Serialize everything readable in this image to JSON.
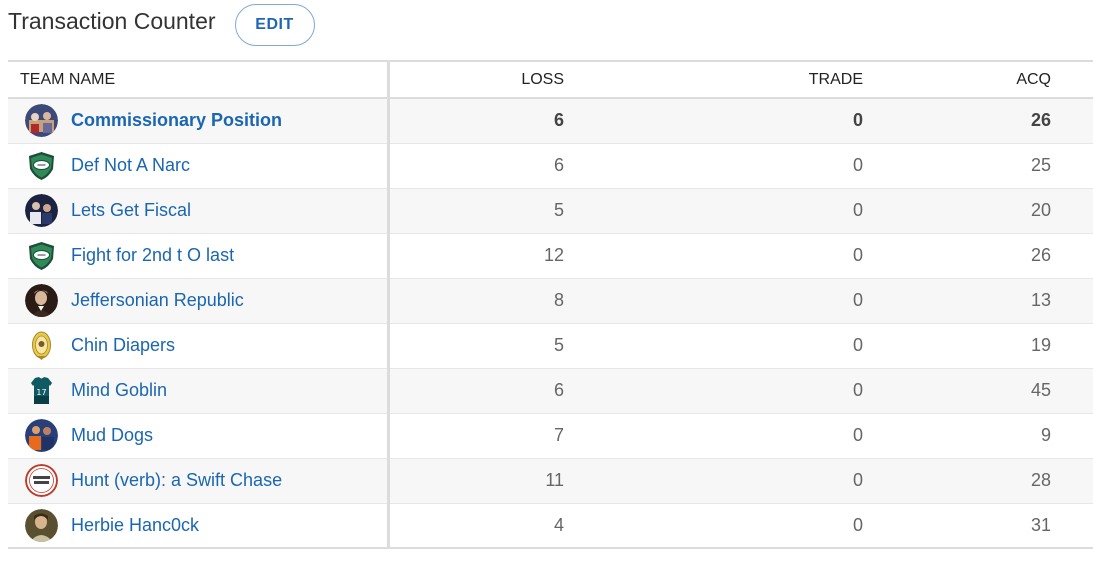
{
  "header": {
    "title": "Transaction Counter",
    "edit_label": "EDIT"
  },
  "columns": {
    "team": "TEAM NAME",
    "loss": "LOSS",
    "trade": "TRADE",
    "acq": "ACQ"
  },
  "rows": [
    {
      "team": "Commissionary Position",
      "loss": "6",
      "trade": "0",
      "acq": "26",
      "avatar": "team-photo-avatar",
      "highlight": true
    },
    {
      "team": "Def Not A Narc",
      "loss": "6",
      "trade": "0",
      "acq": "25",
      "avatar": "football-shield-icon",
      "highlight": false
    },
    {
      "team": "Lets Get Fiscal",
      "loss": "5",
      "trade": "0",
      "acq": "20",
      "avatar": "team-photo-avatar",
      "highlight": false
    },
    {
      "team": "Fight for 2nd t O last",
      "loss": "12",
      "trade": "0",
      "acq": "26",
      "avatar": "football-shield-icon",
      "highlight": false
    },
    {
      "team": "Jeffersonian Republic",
      "loss": "8",
      "trade": "0",
      "acq": "13",
      "avatar": "portrait-avatar",
      "highlight": false
    },
    {
      "team": "Chin Diapers",
      "loss": "5",
      "trade": "0",
      "acq": "19",
      "avatar": "crest-avatar",
      "highlight": false
    },
    {
      "team": "Mind Goblin",
      "loss": "6",
      "trade": "0",
      "acq": "45",
      "avatar": "jersey-avatar",
      "highlight": false
    },
    {
      "team": "Mud Dogs",
      "loss": "7",
      "trade": "0",
      "acq": "9",
      "avatar": "team-photo-avatar",
      "highlight": false
    },
    {
      "team": "Hunt (verb): a Swift Chase",
      "loss": "11",
      "trade": "0",
      "acq": "28",
      "avatar": "badge-logo-avatar",
      "highlight": false
    },
    {
      "team": "Herbie Hanc0ck",
      "loss": "4",
      "trade": "0",
      "acq": "31",
      "avatar": "portrait-avatar",
      "highlight": false
    }
  ],
  "colors": {
    "link": "#1a66b3",
    "shield_green": "#2e8b57",
    "row_alt": "#f7f7f7",
    "border": "#dcdcdc"
  }
}
